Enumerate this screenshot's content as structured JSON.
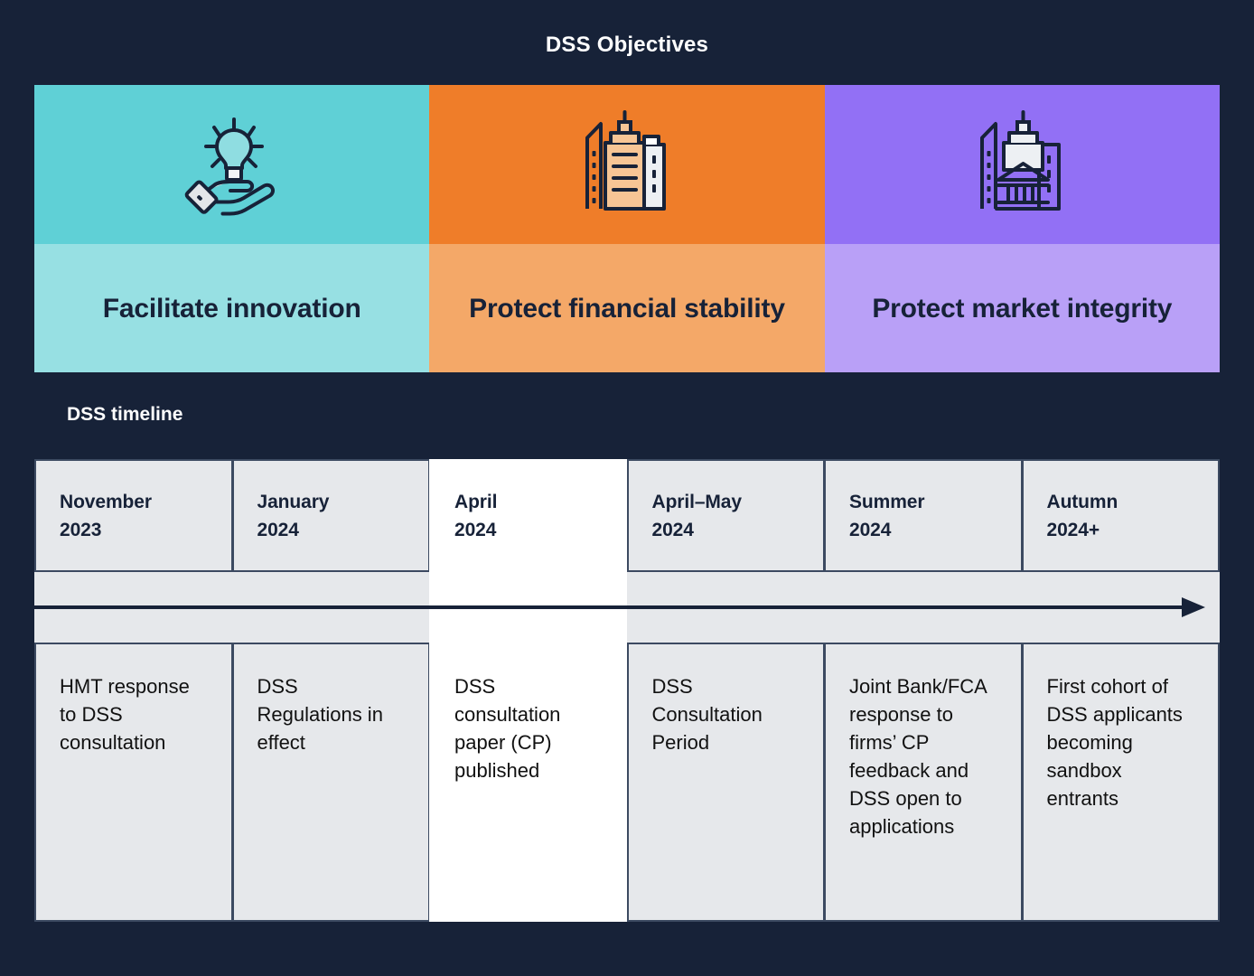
{
  "header": {
    "title": "DSS Objectives"
  },
  "objectives": {
    "cards": [
      {
        "label": "Facilitate innovation",
        "icon": "lightbulb-in-hand-icon",
        "color_top": "#5FD0D6",
        "color_bottom": "#97E0E3"
      },
      {
        "label": "Protect financial stability",
        "icon": "city-buildings-icon",
        "color_top": "#EF7D29",
        "color_bottom": "#F4A868"
      },
      {
        "label": "Protect market integrity",
        "icon": "bank-institution-icon",
        "color_top": "#9270F5",
        "color_bottom": "#B9A0F7"
      }
    ]
  },
  "timeline": {
    "heading": "DSS timeline",
    "arrow_icon": "right-arrow-icon",
    "columns": [
      {
        "period": "November\n2023",
        "event": "HMT response to DSS consultation",
        "highlighted": false
      },
      {
        "period": "January\n2024",
        "event": "DSS Regulations in effect",
        "highlighted": false
      },
      {
        "period": "April\n2024",
        "event": "DSS consultation paper (CP) published",
        "highlighted": true
      },
      {
        "period": "April–May\n2024",
        "event": "DSS Consultation Period",
        "highlighted": false
      },
      {
        "period": "Summer\n2024",
        "event": "Joint Bank/FCA response to firms’ CP feedback and DSS open to applications",
        "highlighted": false
      },
      {
        "period": "Autumn\n2024+",
        "event": "First cohort of DSS applicants becoming sandbox entrants",
        "highlighted": false
      }
    ]
  },
  "colors": {
    "background": "#172238",
    "cell_grey": "#E6E8EB",
    "cell_white": "#FFFFFF",
    "border": "#3C4A61",
    "text_dark": "#172238",
    "text_light": "#FFFFFF"
  }
}
